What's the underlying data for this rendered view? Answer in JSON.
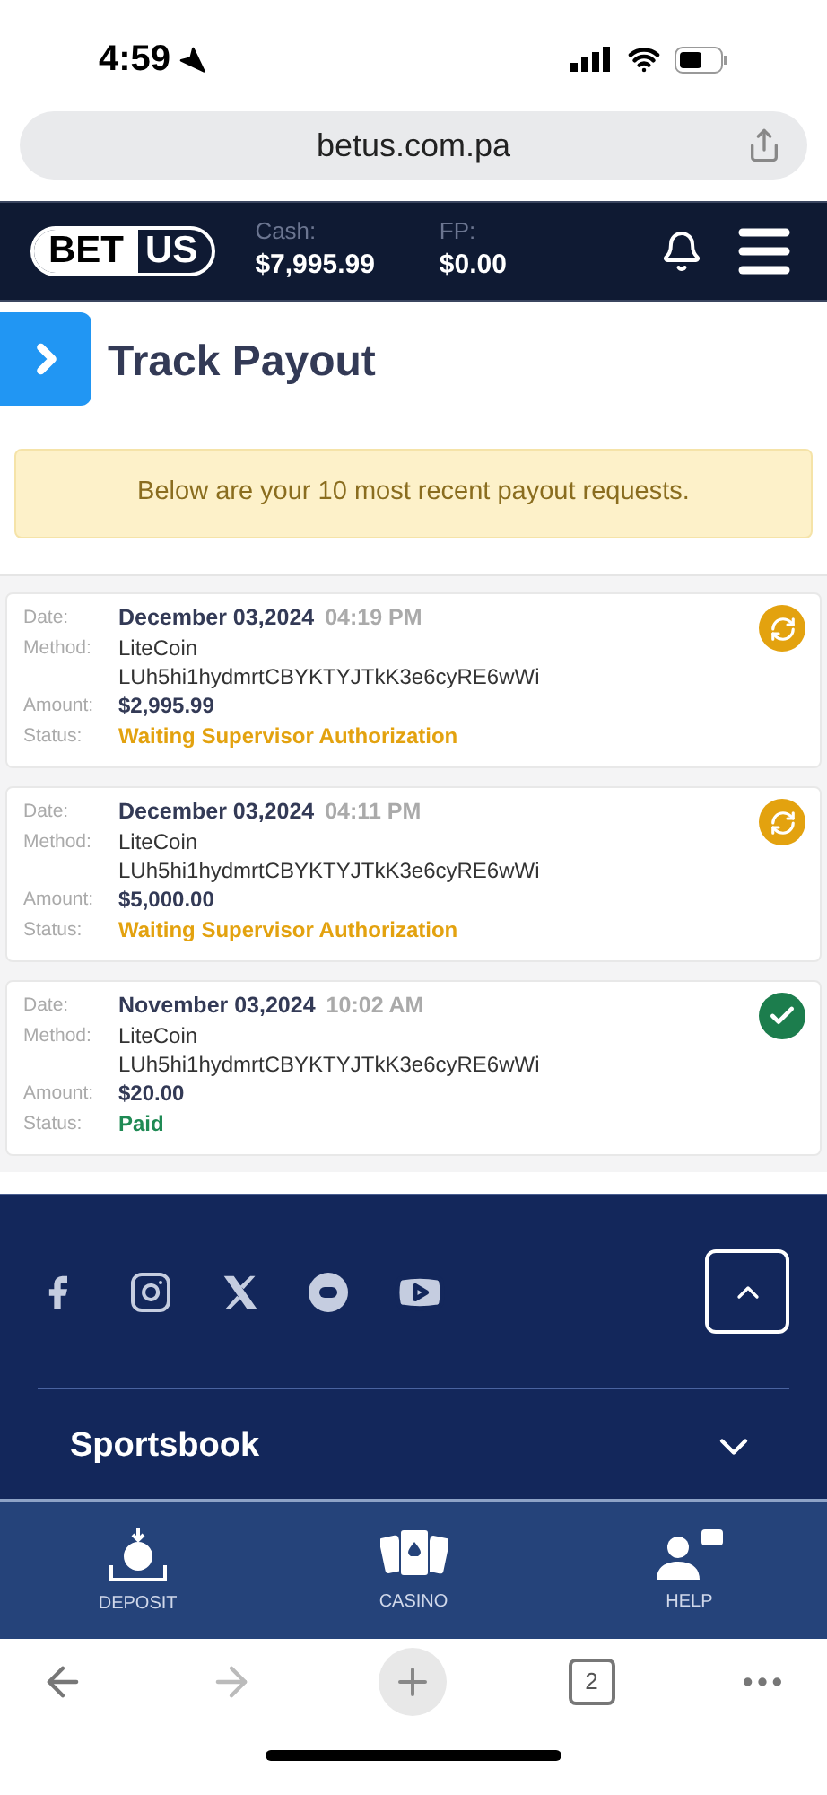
{
  "status_bar": {
    "time": "4:59"
  },
  "browser": {
    "url": "betus.com.pa",
    "tab_count": "2"
  },
  "header": {
    "logo_left": "BET",
    "logo_right": "US",
    "cash_label": "Cash:",
    "cash_value": "$7,995.99",
    "fp_label": "FP:",
    "fp_value": "$0.00"
  },
  "page": {
    "title": "Track Payout",
    "notice": "Below are your 10 most recent payout requests."
  },
  "payouts": [
    {
      "labels": {
        "date": "Date:",
        "method": "Method:",
        "amount": "Amount:",
        "status": "Status:"
      },
      "date": "December 03,2024",
      "time": "04:19 PM",
      "method": "LiteCoin",
      "address": "LUh5hi1hydmrtCBYKTYJTkK3e6cyRE6wWi",
      "amount": "$2,995.99",
      "status": "Waiting Supervisor Authorization",
      "kind": "pending"
    },
    {
      "labels": {
        "date": "Date:",
        "method": "Method:",
        "amount": "Amount:",
        "status": "Status:"
      },
      "date": "December 03,2024",
      "time": "04:11 PM",
      "method": "LiteCoin",
      "address": "LUh5hi1hydmrtCBYKTYJTkK3e6cyRE6wWi",
      "amount": "$5,000.00",
      "status": "Waiting Supervisor Authorization",
      "kind": "pending"
    },
    {
      "labels": {
        "date": "Date:",
        "method": "Method:",
        "amount": "Amount:",
        "status": "Status:"
      },
      "date": "November 03,2024",
      "time": "10:02 AM",
      "method": "LiteCoin",
      "address": "LUh5hi1hydmrtCBYKTYJTkK3e6cyRE6wWi",
      "amount": "$20.00",
      "status": "Paid",
      "kind": "paid"
    }
  ],
  "footer": {
    "section": "Sportsbook",
    "expanded": false
  },
  "bottom_nav": [
    {
      "label": "DEPOSIT",
      "kind": "deposit"
    },
    {
      "label": "CASINO",
      "kind": "casino"
    },
    {
      "label": "HELP",
      "kind": "help"
    }
  ]
}
